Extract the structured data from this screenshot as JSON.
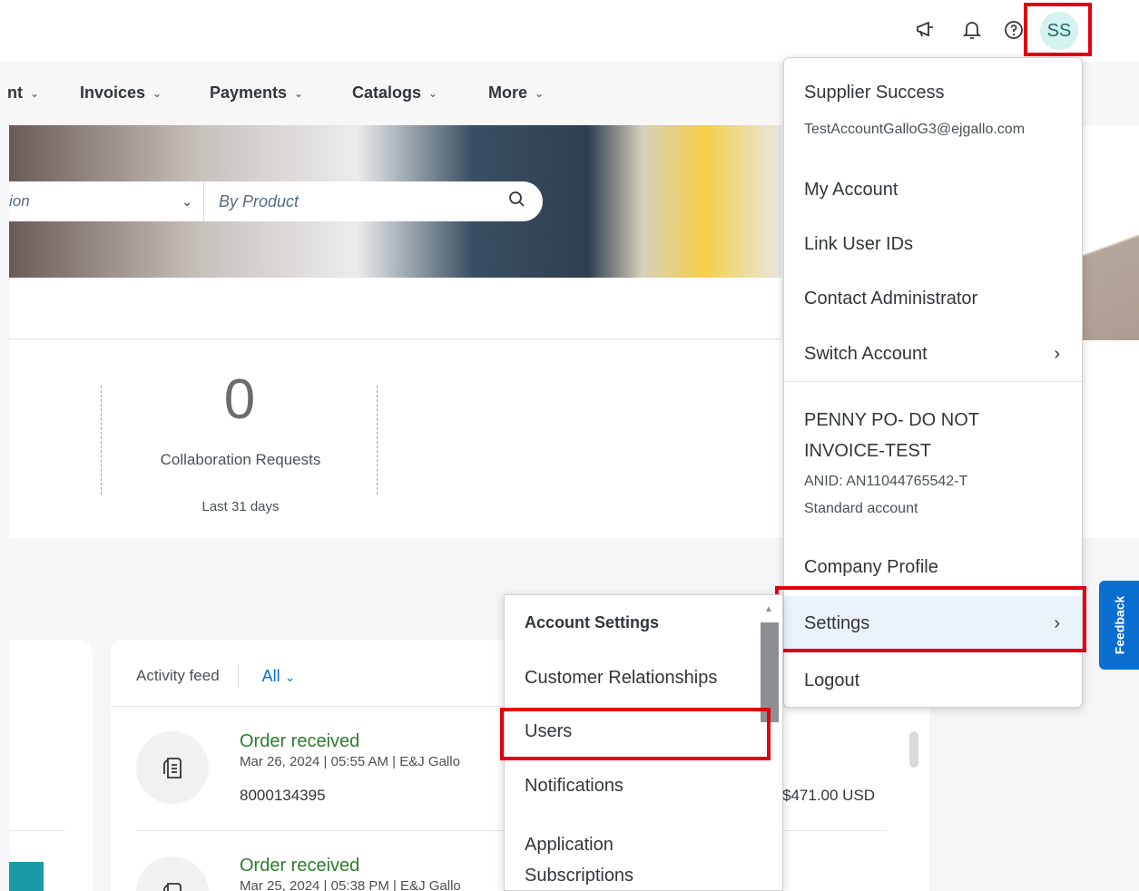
{
  "header": {
    "avatar_initials": "SS"
  },
  "nav": {
    "items": [
      {
        "label": "nt"
      },
      {
        "label": "Invoices"
      },
      {
        "label": "Payments"
      },
      {
        "label": "Catalogs"
      },
      {
        "label": "More"
      }
    ]
  },
  "search": {
    "category_value": "ion",
    "product_placeholder": "By Product"
  },
  "stats": {
    "collab_count": "0",
    "collab_label": "Collaboration Requests",
    "collab_period": "Last 31 days"
  },
  "activity": {
    "label": "Activity feed",
    "filter": "All",
    "items": [
      {
        "title": "Order received",
        "meta": "Mar 26, 2024  |  05:55 AM  |  E&J Gallo",
        "id": "8000134395",
        "amount": "$471.00 USD"
      },
      {
        "title": "Order received",
        "meta": "Mar 25, 2024  |  05:38 PM  |  E&J Gallo"
      }
    ]
  },
  "account_menu": {
    "user_name": "Supplier Success",
    "user_email": "TestAccountGalloG3@ejgallo.com",
    "my_account": "My Account",
    "link_user_ids": "Link User IDs",
    "contact_admin": "Contact Administrator",
    "switch_account": "Switch Account",
    "company_name": "PENNY PO- DO NOT INVOICE-TEST",
    "anid": "ANID: AN11044765542-T",
    "account_type": "Standard account",
    "company_profile": "Company Profile",
    "settings": "Settings",
    "logout": "Logout"
  },
  "settings_submenu": {
    "heading": "Account Settings",
    "customer_relationships": "Customer Relationships",
    "users": "Users",
    "notifications": "Notifications",
    "app_subscriptions": "Application Subscriptions"
  },
  "feedback": {
    "label": "Feedback"
  },
  "colors": {
    "highlight_border": "#e3000f",
    "link_blue": "#0a6ed1",
    "order_green": "#2b7d2b",
    "avatar_bg": "#d4f2ef"
  }
}
